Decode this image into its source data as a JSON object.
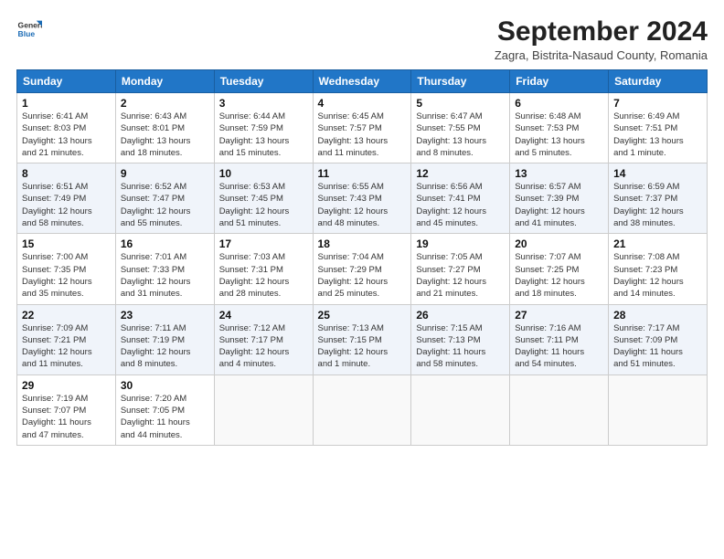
{
  "logo": {
    "line1": "General",
    "line2": "Blue"
  },
  "title": "September 2024",
  "location": "Zagra, Bistrita-Nasaud County, Romania",
  "days_header": [
    "Sunday",
    "Monday",
    "Tuesday",
    "Wednesday",
    "Thursday",
    "Friday",
    "Saturday"
  ],
  "weeks": [
    [
      {
        "day": "1",
        "info": "Sunrise: 6:41 AM\nSunset: 8:03 PM\nDaylight: 13 hours\nand 21 minutes."
      },
      {
        "day": "2",
        "info": "Sunrise: 6:43 AM\nSunset: 8:01 PM\nDaylight: 13 hours\nand 18 minutes."
      },
      {
        "day": "3",
        "info": "Sunrise: 6:44 AM\nSunset: 7:59 PM\nDaylight: 13 hours\nand 15 minutes."
      },
      {
        "day": "4",
        "info": "Sunrise: 6:45 AM\nSunset: 7:57 PM\nDaylight: 13 hours\nand 11 minutes."
      },
      {
        "day": "5",
        "info": "Sunrise: 6:47 AM\nSunset: 7:55 PM\nDaylight: 13 hours\nand 8 minutes."
      },
      {
        "day": "6",
        "info": "Sunrise: 6:48 AM\nSunset: 7:53 PM\nDaylight: 13 hours\nand 5 minutes."
      },
      {
        "day": "7",
        "info": "Sunrise: 6:49 AM\nSunset: 7:51 PM\nDaylight: 13 hours\nand 1 minute."
      }
    ],
    [
      {
        "day": "8",
        "info": "Sunrise: 6:51 AM\nSunset: 7:49 PM\nDaylight: 12 hours\nand 58 minutes."
      },
      {
        "day": "9",
        "info": "Sunrise: 6:52 AM\nSunset: 7:47 PM\nDaylight: 12 hours\nand 55 minutes."
      },
      {
        "day": "10",
        "info": "Sunrise: 6:53 AM\nSunset: 7:45 PM\nDaylight: 12 hours\nand 51 minutes."
      },
      {
        "day": "11",
        "info": "Sunrise: 6:55 AM\nSunset: 7:43 PM\nDaylight: 12 hours\nand 48 minutes."
      },
      {
        "day": "12",
        "info": "Sunrise: 6:56 AM\nSunset: 7:41 PM\nDaylight: 12 hours\nand 45 minutes."
      },
      {
        "day": "13",
        "info": "Sunrise: 6:57 AM\nSunset: 7:39 PM\nDaylight: 12 hours\nand 41 minutes."
      },
      {
        "day": "14",
        "info": "Sunrise: 6:59 AM\nSunset: 7:37 PM\nDaylight: 12 hours\nand 38 minutes."
      }
    ],
    [
      {
        "day": "15",
        "info": "Sunrise: 7:00 AM\nSunset: 7:35 PM\nDaylight: 12 hours\nand 35 minutes."
      },
      {
        "day": "16",
        "info": "Sunrise: 7:01 AM\nSunset: 7:33 PM\nDaylight: 12 hours\nand 31 minutes."
      },
      {
        "day": "17",
        "info": "Sunrise: 7:03 AM\nSunset: 7:31 PM\nDaylight: 12 hours\nand 28 minutes."
      },
      {
        "day": "18",
        "info": "Sunrise: 7:04 AM\nSunset: 7:29 PM\nDaylight: 12 hours\nand 25 minutes."
      },
      {
        "day": "19",
        "info": "Sunrise: 7:05 AM\nSunset: 7:27 PM\nDaylight: 12 hours\nand 21 minutes."
      },
      {
        "day": "20",
        "info": "Sunrise: 7:07 AM\nSunset: 7:25 PM\nDaylight: 12 hours\nand 18 minutes."
      },
      {
        "day": "21",
        "info": "Sunrise: 7:08 AM\nSunset: 7:23 PM\nDaylight: 12 hours\nand 14 minutes."
      }
    ],
    [
      {
        "day": "22",
        "info": "Sunrise: 7:09 AM\nSunset: 7:21 PM\nDaylight: 12 hours\nand 11 minutes."
      },
      {
        "day": "23",
        "info": "Sunrise: 7:11 AM\nSunset: 7:19 PM\nDaylight: 12 hours\nand 8 minutes."
      },
      {
        "day": "24",
        "info": "Sunrise: 7:12 AM\nSunset: 7:17 PM\nDaylight: 12 hours\nand 4 minutes."
      },
      {
        "day": "25",
        "info": "Sunrise: 7:13 AM\nSunset: 7:15 PM\nDaylight: 12 hours\nand 1 minute."
      },
      {
        "day": "26",
        "info": "Sunrise: 7:15 AM\nSunset: 7:13 PM\nDaylight: 11 hours\nand 58 minutes."
      },
      {
        "day": "27",
        "info": "Sunrise: 7:16 AM\nSunset: 7:11 PM\nDaylight: 11 hours\nand 54 minutes."
      },
      {
        "day": "28",
        "info": "Sunrise: 7:17 AM\nSunset: 7:09 PM\nDaylight: 11 hours\nand 51 minutes."
      }
    ],
    [
      {
        "day": "29",
        "info": "Sunrise: 7:19 AM\nSunset: 7:07 PM\nDaylight: 11 hours\nand 47 minutes."
      },
      {
        "day": "30",
        "info": "Sunrise: 7:20 AM\nSunset: 7:05 PM\nDaylight: 11 hours\nand 44 minutes."
      },
      {
        "day": "",
        "info": ""
      },
      {
        "day": "",
        "info": ""
      },
      {
        "day": "",
        "info": ""
      },
      {
        "day": "",
        "info": ""
      },
      {
        "day": "",
        "info": ""
      }
    ]
  ]
}
